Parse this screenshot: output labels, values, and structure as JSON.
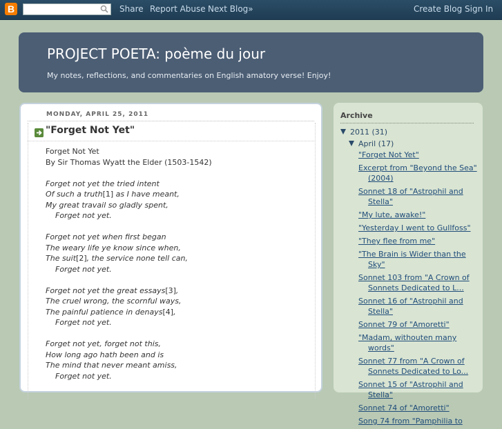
{
  "navbar": {
    "logo_letter": "B",
    "search_value": "",
    "links": {
      "share": "Share",
      "report_abuse": "Report Abuse",
      "next_blog": "Next Blog»",
      "create_blog": "Create Blog",
      "sign_in": "Sign In"
    }
  },
  "header": {
    "title": "PROJECT POETA: poème du jour",
    "description": "My notes, reflections, and commentaries on English amatory verse! Enjoy!"
  },
  "post": {
    "date": "MONDAY, APRIL 25, 2011",
    "title": "\"Forget Not Yet\"",
    "intro": [
      "Forget Not Yet",
      "By Sir Thomas Wyatt the Elder (1503-1542)"
    ],
    "stanzas": [
      [
        "Forget not yet the tried intent",
        "Of such a truth|[1]| as I have meant,",
        "My great travail so gladly spent,",
        "Forget not yet."
      ],
      [
        "Forget not yet when first began",
        "The weary life ye know since when,",
        "The suit|[2]|, the service none tell can,",
        "Forget not yet."
      ],
      [
        "Forget not yet the great essays|[3]|,",
        "The cruel wrong, the scornful ways,",
        "The painful patience in denays|[4]|,",
        "Forget not yet."
      ],
      [
        "Forget not yet, forget not this,",
        "How long ago hath been and is",
        "The mind that never meant amiss,",
        "Forget not yet."
      ]
    ]
  },
  "sidebar": {
    "archive_title": "Archive",
    "year": "2011",
    "year_count": "(31)",
    "month": "April",
    "month_count": "(17)",
    "posts": [
      "\"Forget Not Yet\"",
      "Excerpt from \"Beyond the Sea\" (2004)",
      "Sonnet 18 of \"Astrophil and Stella\"",
      "\"My lute, awake!\"",
      "\"Yesterday I went to Gullfoss\"",
      "\"They flee from me\"",
      "\"The Brain is Wider than the Sky\"",
      "Sonnet 103 from \"A Crown of Sonnets Dedicated to L...",
      "Sonnet 16 of \"Astrophil and Stella\"",
      "Sonnet 79 of \"Amoretti\"",
      "\"Madam, withouten many words\"",
      "Sonnet 77 from \"A Crown of Sonnets Dedicated to Lo...",
      "Sonnet 15 of \"Astrophil and Stella\"",
      "Sonnet 74 of \"Amoretti\"",
      "Song 74 from \"Pamphilia to"
    ]
  },
  "colors": {
    "page_bg": "#b9c9b4",
    "navbar": "#1f3d54",
    "header_bg": "#4c5e74",
    "sidebar_bg": "#d9e4d2",
    "link": "#1f4c7a",
    "blogger_orange": "#f57d00"
  }
}
